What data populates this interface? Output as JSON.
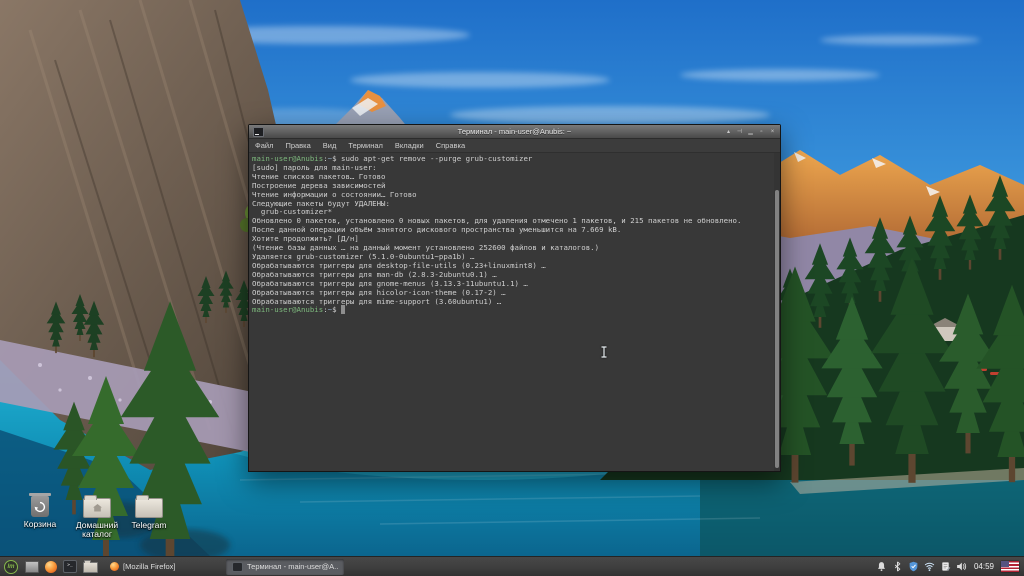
{
  "theme": {
    "colors": {
      "sky-top": "#1f6fc9",
      "sky-mid": "#3e9ade",
      "sky-low": "#8ed2f0",
      "mtn-orange": "#e2883a",
      "mtn-rock": "#9187a6",
      "cliff-light": "#8a7766",
      "cliff-dark": "#4a3f35",
      "forest-dark": "#16381f",
      "pine-green": "#2c5a28",
      "lake-bright": "#27bede",
      "lake-mid": "#0f8db4",
      "lake-deep": "#0a5d86",
      "terminal-bg": "#383838",
      "terminal-fg": "#cfcfcf",
      "prompt-green": "#7db87d",
      "prompt-path": "#8fa7c4",
      "panel-bg": "#3d3d3d",
      "mint-green": "#86b84c",
      "titlebar-top": "#7a7a7a",
      "titlebar-bottom": "#494949"
    }
  },
  "desktop": {
    "icons": [
      {
        "label": "Корзина"
      },
      {
        "label": "Домашний каталог"
      },
      {
        "label": "Telegram"
      }
    ]
  },
  "terminal": {
    "title": "Терминал - main-user@Anubis: ~",
    "window_buttons": [
      {
        "name": "shade",
        "glyph": "▴"
      },
      {
        "name": "pin",
        "glyph": "⊣"
      },
      {
        "name": "minimize",
        "glyph": "▁"
      },
      {
        "name": "maximize",
        "glyph": "▫"
      },
      {
        "name": "close",
        "glyph": "×"
      }
    ],
    "menu": [
      "Файл",
      "Правка",
      "Вид",
      "Терминал",
      "Вкладки",
      "Справка"
    ],
    "lines": [
      {
        "seg": [
          {
            "c": "u",
            "t": "main-user@Anubis"
          },
          {
            "c": "w",
            "t": ":"
          },
          {
            "c": "d",
            "t": "~"
          },
          {
            "c": "w",
            "t": "$ "
          },
          {
            "c": "f",
            "t": "sudo apt-get remove --purge grub-customizer"
          }
        ]
      },
      {
        "seg": [
          {
            "c": "f",
            "t": "[sudo] пароль для main-user: "
          }
        ]
      },
      {
        "seg": [
          {
            "c": "f",
            "t": "Чтение списков пакетов… Готово"
          }
        ]
      },
      {
        "seg": [
          {
            "c": "f",
            "t": "Построение дерева зависимостей"
          }
        ]
      },
      {
        "seg": [
          {
            "c": "f",
            "t": "Чтение информации о состоянии… Готово"
          }
        ]
      },
      {
        "seg": [
          {
            "c": "f",
            "t": "Следующие пакеты будут УДАЛЕНЫ:"
          }
        ]
      },
      {
        "seg": [
          {
            "c": "f",
            "t": "  grub-customizer*"
          }
        ]
      },
      {
        "seg": [
          {
            "c": "f",
            "t": "Обновлено 0 пакетов, установлено 0 новых пакетов, для удаления отмечено 1 пакетов, и 215 пакетов не обновлено."
          }
        ]
      },
      {
        "seg": [
          {
            "c": "f",
            "t": "После данной операции объём занятого дискового пространства уменьшится на 7.669 kB."
          }
        ]
      },
      {
        "seg": [
          {
            "c": "f",
            "t": "Хотите продолжить? [Д/н]"
          }
        ]
      },
      {
        "seg": [
          {
            "c": "f",
            "t": "(Чтение базы данных … на данный момент установлено 252600 файлов и каталогов.)"
          }
        ]
      },
      {
        "seg": [
          {
            "c": "f",
            "t": "Удаляется grub-customizer (5.1.0-0ubuntu1~ppa1b) …"
          }
        ]
      },
      {
        "seg": [
          {
            "c": "f",
            "t": "Обрабатываются триггеры для desktop-file-utils (0.23+linuxmint8) …"
          }
        ]
      },
      {
        "seg": [
          {
            "c": "f",
            "t": "Обрабатываются триггеры для man-db (2.8.3-2ubuntu0.1) …"
          }
        ]
      },
      {
        "seg": [
          {
            "c": "f",
            "t": "Обрабатываются триггеры для gnome-menus (3.13.3-11ubuntu1.1) …"
          }
        ]
      },
      {
        "seg": [
          {
            "c": "f",
            "t": "Обрабатываются триггеры для hicolor-icon-theme (0.17-2) …"
          }
        ]
      },
      {
        "seg": [
          {
            "c": "f",
            "t": "Обрабатываются триггеры для mime-support (3.60ubuntu1) …"
          }
        ]
      },
      {
        "seg": [
          {
            "c": "u",
            "t": "main-user@Anubis"
          },
          {
            "c": "w",
            "t": ":"
          },
          {
            "c": "d",
            "t": "~"
          },
          {
            "c": "w",
            "t": "$ "
          },
          {
            "c": "cursor",
            "t": " "
          }
        ]
      }
    ]
  },
  "taskbar": {
    "menu_button": {
      "logo_text": "lm"
    },
    "windows": [
      {
        "label": "[Mozilla Firefox]",
        "app": "firefox",
        "active": false
      },
      {
        "label": "Терминал - main-user@A...",
        "app": "terminal",
        "active": true
      }
    ],
    "tray": {
      "icons": [
        "notifications",
        "bluetooth",
        "updates-shield",
        "network-wifi",
        "notes",
        "volume"
      ],
      "clock": "04:59",
      "layout_flag": "us-keyboard-layout"
    }
  }
}
